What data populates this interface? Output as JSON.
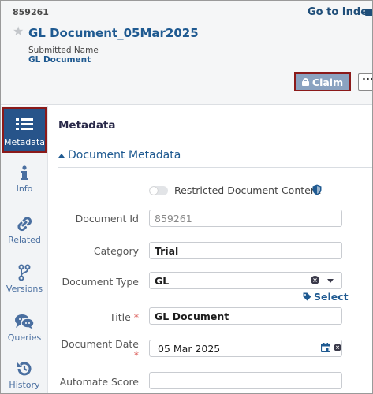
{
  "header": {
    "doc_number": "859261",
    "go_index_label": "Go to Index",
    "title": "GL Document_05Mar2025",
    "submitted_name_label": "Submitted Name",
    "submitted_name_value": "GL Document",
    "claim_label": "Claim",
    "more_label": "···"
  },
  "sidebar": {
    "items": [
      {
        "label": "Metadata",
        "icon": "list-icon",
        "active": true
      },
      {
        "label": "Info",
        "icon": "info-icon"
      },
      {
        "label": "Related",
        "icon": "link-icon"
      },
      {
        "label": "Versions",
        "icon": "branch-icon"
      },
      {
        "label": "Queries",
        "icon": "chat-icon"
      },
      {
        "label": "History",
        "icon": "history-icon"
      }
    ]
  },
  "main": {
    "title": "Metadata",
    "section_title": "Document Metadata",
    "restricted_label": "Restricted Document Content",
    "fields": {
      "document_id": {
        "label": "Document Id",
        "value": "859261"
      },
      "category": {
        "label": "Category",
        "value": "Trial"
      },
      "document_type": {
        "label": "Document Type",
        "value": "GL",
        "link": "Select"
      },
      "title": {
        "label": "Title",
        "value": "GL Document",
        "required": "*"
      },
      "document_date": {
        "label": "Document Date",
        "value": "05 Mar 2025",
        "required": "*"
      },
      "automate_score": {
        "label": "Automate Score",
        "value": ""
      }
    }
  },
  "colors": {
    "accent": "#1f5a91",
    "active_nav": "#27548a",
    "highlight_border": "#8b1a1a",
    "claim_button": "#8aa2c0"
  }
}
